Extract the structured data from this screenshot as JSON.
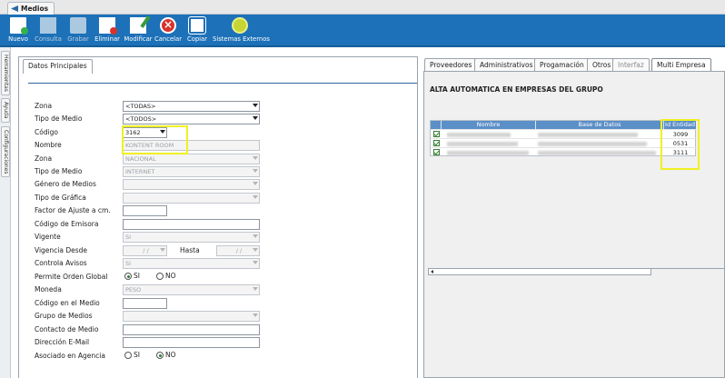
{
  "app_tab": {
    "title": "Medios"
  },
  "toolbar": {
    "buttons": [
      {
        "label": "Nuevo",
        "icon": "new-doc-icon",
        "enabled": true
      },
      {
        "label": "Consulta",
        "icon": "query-icon",
        "enabled": false
      },
      {
        "label": "Grabar",
        "icon": "save-icon",
        "enabled": false
      },
      {
        "label": "Eliminar",
        "icon": "delete-icon",
        "enabled": true
      },
      {
        "label": "Modificar",
        "icon": "edit-icon",
        "enabled": true
      },
      {
        "label": "Cancelar",
        "icon": "cancel-icon",
        "enabled": true
      },
      {
        "label": "Copiar",
        "icon": "copy-icon",
        "enabled": true
      },
      {
        "label": "Sistemas Externos",
        "icon": "external-systems-icon",
        "enabled": true
      }
    ]
  },
  "sidebar": {
    "tabs": [
      "Herramientas",
      "Ayuda",
      "Configuraciones"
    ]
  },
  "left_panel": {
    "tab": "Datos Principales",
    "fields": {
      "zona_filter": {
        "label": "Zona",
        "value": "<TODAS>"
      },
      "tipo_filter": {
        "label": "Tipo de Medio",
        "value": "<TODOS>"
      },
      "codigo": {
        "label": "Código",
        "value": "3162"
      },
      "nombre": {
        "label": "Nombre",
        "value": "KONTENT ROOM"
      },
      "zona": {
        "label": "Zona",
        "value": "NACIONAL"
      },
      "tipo_medio": {
        "label": "Tipo de Medio",
        "value": "INTERNET"
      },
      "genero": {
        "label": "Género de Medios",
        "value": ""
      },
      "tipo_grafica": {
        "label": "Tipo de Gráfica",
        "value": ""
      },
      "factor": {
        "label": "Factor de Ajuste a cm.",
        "value": ""
      },
      "codigo_emisora": {
        "label": "Código de Emisora",
        "value": ""
      },
      "vigente": {
        "label": "Vigente",
        "value": "SI"
      },
      "vigencia_desde": {
        "label": "Vigencia Desde",
        "value": "/ /",
        "hasta_label": "Hasta",
        "hasta_value": "/ /"
      },
      "controla_avisos": {
        "label": "Controla Avisos",
        "value": "SI"
      },
      "permite_orden": {
        "label": "Permite Orden Global",
        "opt_si": "SI",
        "opt_no": "NO",
        "selected": "SI"
      },
      "moneda": {
        "label": "Moneda",
        "value": "PESO"
      },
      "codigo_medio": {
        "label": "Código en el Medio",
        "value": ""
      },
      "grupo_medios": {
        "label": "Grupo de Medios",
        "value": ""
      },
      "contacto": {
        "label": "Contacto de Medio",
        "value": ""
      },
      "email": {
        "label": "Dirección E-Mail",
        "value": ""
      },
      "asociado": {
        "label": "Asociado en Agencia",
        "opt_si": "SI",
        "opt_no": "NO",
        "selected": "NO"
      }
    }
  },
  "right_panel": {
    "tabs": [
      "Proveedores",
      "Administrativos",
      "Progamación",
      "Otros",
      "Interfaz",
      "Multi Empresa"
    ],
    "active_tab": "Multi Empresa",
    "title": "ALTA AUTOMATICA EN EMPRESAS DEL GRUPO",
    "grid": {
      "columns": [
        "Nombre",
        "Base de Datos",
        "Id Entidad"
      ],
      "rows": [
        {
          "checked": true,
          "id": "3099"
        },
        {
          "checked": true,
          "id": "0531"
        },
        {
          "checked": true,
          "id": "3111"
        }
      ]
    }
  },
  "colors": {
    "toolbar_bg": "#1d71b8",
    "header_bg": "#5b8fc7",
    "highlight": "#f0f022",
    "accent_line": "#2e64a5"
  }
}
